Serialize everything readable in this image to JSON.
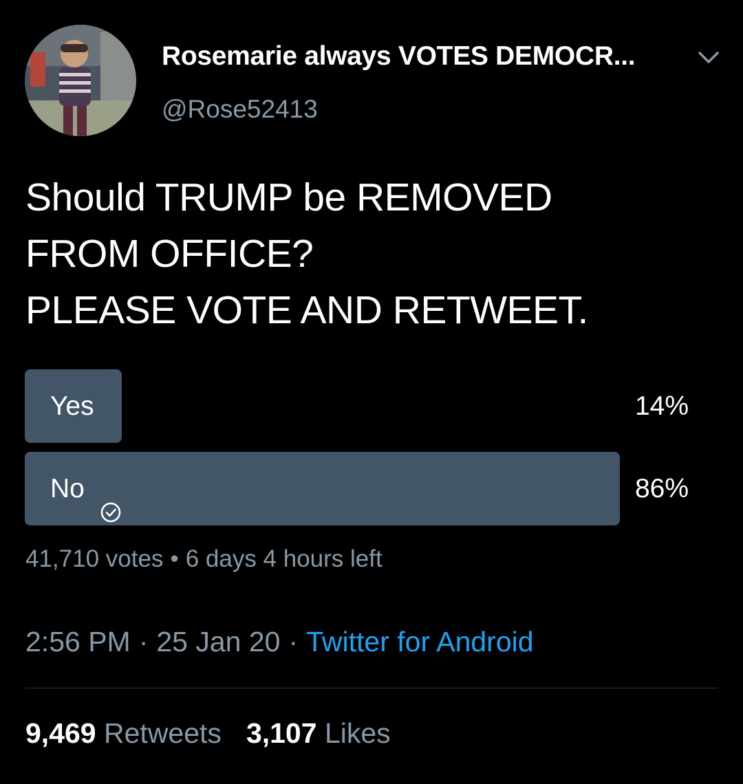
{
  "header": {
    "display_name": "Rosemarie always VOTES DEMOCR...",
    "handle": "@Rose52413",
    "avatar_icon": "profile-photo",
    "menu_icon": "chevron-down-icon"
  },
  "tweet": {
    "text_lines": [
      "Should TRUMP be REMOVED",
      "FROM OFFICE?",
      "PLEASE VOTE AND RETWEET."
    ]
  },
  "poll": {
    "options": [
      {
        "label": "Yes",
        "percent_text": "14%",
        "percent": 14,
        "voted": false
      },
      {
        "label": "No",
        "percent_text": "86%",
        "percent": 86,
        "voted": true
      }
    ],
    "votes": "41,710 votes",
    "separator": "•",
    "time_left": "6 days 4 hours left",
    "fill_color": "#435668"
  },
  "meta": {
    "time": "2:56 PM",
    "date": "25 Jan 20",
    "separator": "·",
    "source": "Twitter for Android",
    "source_color": "#1da1f2"
  },
  "stats": {
    "retweets_count": "9,469",
    "retweets_label": "Retweets",
    "likes_count": "3,107",
    "likes_label": "Likes"
  }
}
